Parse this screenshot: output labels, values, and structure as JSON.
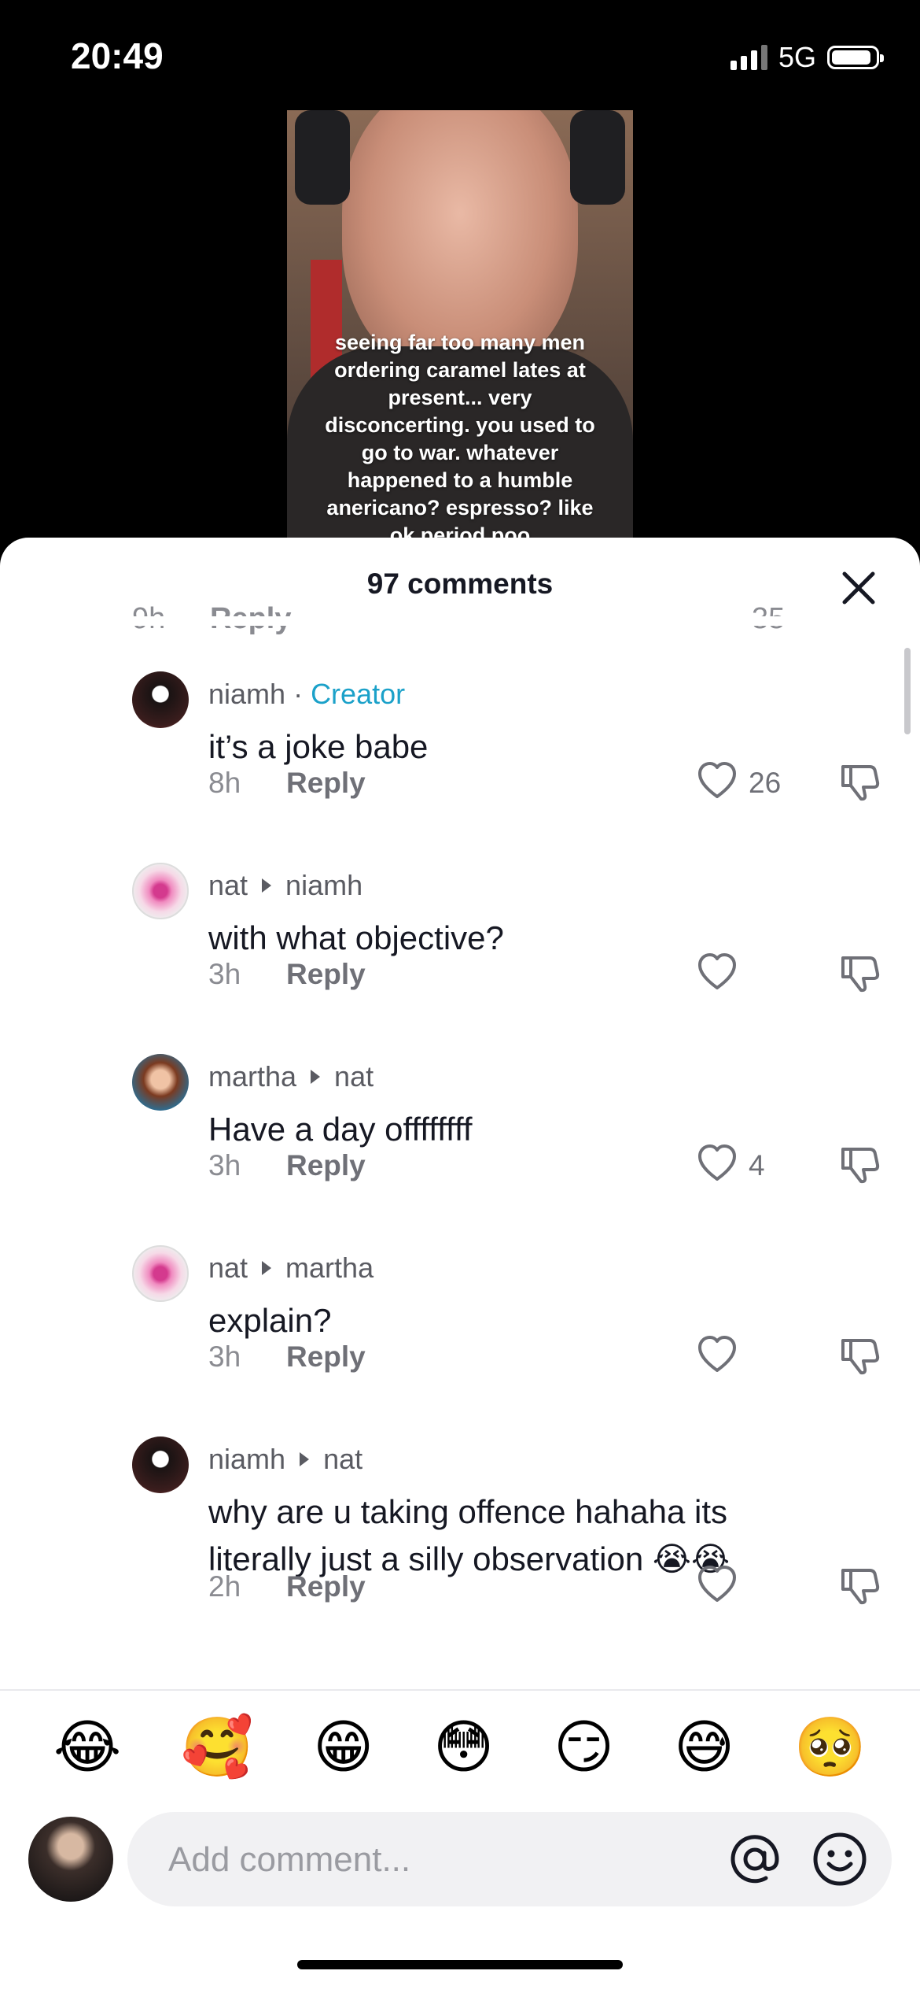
{
  "status_bar": {
    "time": "20:49",
    "network": "5G",
    "signal_bars": 3,
    "battery_level": 0.9
  },
  "video": {
    "caption": "seeing far too many men\nordering caramel lates at\npresent... very\ndisconcerting. you used to\ngo to war. whatever\nhappened to a humble\nanericano? espresso? like\nok period poo"
  },
  "sheet": {
    "title": "97 comments",
    "close_icon": "close-icon"
  },
  "partial_comment": {
    "time": "9h",
    "reply_label": "Reply",
    "likes": "35"
  },
  "comments": [
    {
      "user": "niamh",
      "creator_label": "Creator",
      "reply_to": "",
      "text": "it’s a joke babe",
      "time": "8h",
      "reply_label": "Reply",
      "likes": "26",
      "avatar": "niamh"
    },
    {
      "user": "nat",
      "creator_label": "",
      "reply_to": "niamh",
      "text": "with what objective?",
      "time": "3h",
      "reply_label": "Reply",
      "likes": "",
      "avatar": "nat"
    },
    {
      "user": "martha",
      "creator_label": "",
      "reply_to": "nat",
      "text": "Have a day offffffff",
      "time": "3h",
      "reply_label": "Reply",
      "likes": "4",
      "avatar": "martha"
    },
    {
      "user": "nat",
      "creator_label": "",
      "reply_to": "martha",
      "text": "explain?",
      "time": "3h",
      "reply_label": "Reply",
      "likes": "",
      "avatar": "nat"
    },
    {
      "user": "niamh",
      "creator_label": "",
      "reply_to": "nat",
      "text": "why are u taking offence hahaha its literally just a silly observation 😭😭",
      "time": "2h",
      "reply_label": "Reply",
      "likes": "",
      "avatar": "niamh"
    }
  ],
  "emoji_bar": [
    "😂",
    "🥰",
    "😁",
    "😳",
    "😏",
    "😅",
    "🥺"
  ],
  "composer": {
    "placeholder": "Add comment...",
    "at_icon": "at-icon",
    "emoji_icon": "smiley-icon"
  },
  "colors": {
    "creator": "#1ba1c9",
    "text": "#161823",
    "muted": "#8a8b91"
  }
}
